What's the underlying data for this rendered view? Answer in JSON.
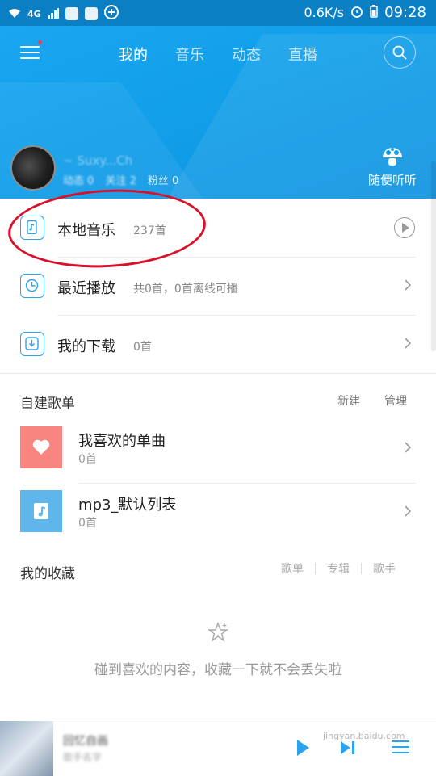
{
  "status_bar": {
    "network": "4G",
    "speed": "0.6K/s",
    "time": "09:28"
  },
  "header": {
    "tabs": [
      {
        "label": "我的",
        "active": true
      },
      {
        "label": "音乐",
        "active": false
      },
      {
        "label": "动态",
        "active": false
      },
      {
        "label": "直播",
        "active": false
      }
    ],
    "icons": [
      "menu-icon",
      "search-icon"
    ]
  },
  "profile": {
    "username": "~ Suxy...Ch",
    "stats": [
      {
        "label": "动态",
        "value": "0"
      },
      {
        "label": "关注",
        "value": "2"
      },
      {
        "label": "粉丝",
        "value": "0"
      }
    ],
    "random_listen_label": "随便听听"
  },
  "library": [
    {
      "title": "本地音乐",
      "subtitle": "237首",
      "action": "play",
      "icon": "phone-music-icon"
    },
    {
      "title": "最近播放",
      "subtitle": "共0首，0首离线可播",
      "action": "chevron",
      "icon": "clock-icon"
    },
    {
      "title": "我的下载",
      "subtitle": "0首",
      "action": "chevron",
      "icon": "download-icon"
    }
  ],
  "playlists_section": {
    "title": "自建歌单",
    "new_label": "新建",
    "manage_label": "管理",
    "items": [
      {
        "name": "我喜欢的单曲",
        "count": "0首",
        "cover_color": "#f8857f",
        "icon": "heart-icon"
      },
      {
        "name": "mp3_默认列表",
        "count": "0首",
        "cover_color": "#5fb6ea",
        "icon": "music-note-icon"
      }
    ]
  },
  "collection_section": {
    "title": "我的收藏",
    "tabs": [
      "歌单",
      "专辑",
      "歌手"
    ],
    "empty_text": "碰到喜欢的内容，收藏一下就不会丢失啦"
  },
  "mini_player": {
    "song": "回忆自画",
    "artist": "歌手名字"
  },
  "watermark": "jingyan.baidu.com",
  "colors": {
    "header_blue": "#129fe9",
    "accent": "#2ba4ec",
    "annotation_red": "#d8102a"
  }
}
